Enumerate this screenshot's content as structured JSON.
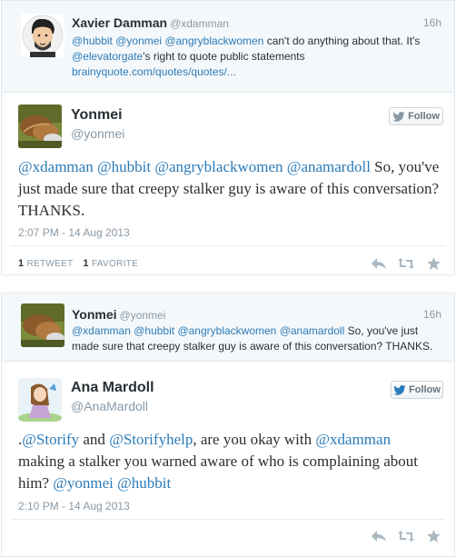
{
  "embed1": {
    "context": {
      "name": "Xavier Damman",
      "handle": "@xdamman",
      "time": "16h",
      "text_mentions": [
        "@hubbit",
        "@yonmei",
        "@angryblackwomen"
      ],
      "text_part1": " can't do anything about that. It's ",
      "text_mention2": "@elevatorgate",
      "text_part2": "'s right to quote public statements",
      "link": "brainyquote.com/quotes/quotes/..."
    },
    "main": {
      "name": "Yonmei",
      "handle": "@yonmei",
      "follow_label": "Follow",
      "mentions": [
        "@xdamman",
        "@hubbit",
        "@angryblackwomen",
        "@anamardoll"
      ],
      "text": "So, you've just made sure that creepy stalker guy is aware of this conversation? THANKS.",
      "timestamp": "2:07 PM - 14 Aug 2013",
      "retweets_count": "1",
      "retweets_label": "RETWEET",
      "favorites_count": "1",
      "favorites_label": "FAVORITE"
    }
  },
  "embed2": {
    "context": {
      "name": "Yonmei",
      "handle": "@yonmei",
      "time": "16h",
      "text_mentions": [
        "@xdamman",
        "@hubbit",
        "@angryblackwomen",
        "@anamardoll"
      ],
      "text_part1": " So, you've just made sure that creepy stalker guy is aware of this conversation? THANKS."
    },
    "main": {
      "name": "Ana Mardoll",
      "handle": "@AnaMardoll",
      "follow_label": "Follow",
      "prefix": ".",
      "mention_storify": "@Storify",
      "and": " and ",
      "mention_storifyhelp": "@Storifyhelp",
      "part1": ", are you okay with ",
      "mention_xdamman": "@xdamman",
      "part2": " making a stalker you warned aware of who is complaining about him? ",
      "mention_yonmei": "@yonmei",
      "space": " ",
      "mention_hubbit": "@hubbit",
      "timestamp": "2:10 PM - 14 Aug 2013"
    }
  },
  "colors": {
    "link": "#2b7bb9",
    "follow_blue": "#2b7bb9",
    "muted": "#8899a6"
  },
  "icons": [
    "reply-icon",
    "retweet-icon",
    "favorite-icon",
    "twitter-bird-icon"
  ]
}
